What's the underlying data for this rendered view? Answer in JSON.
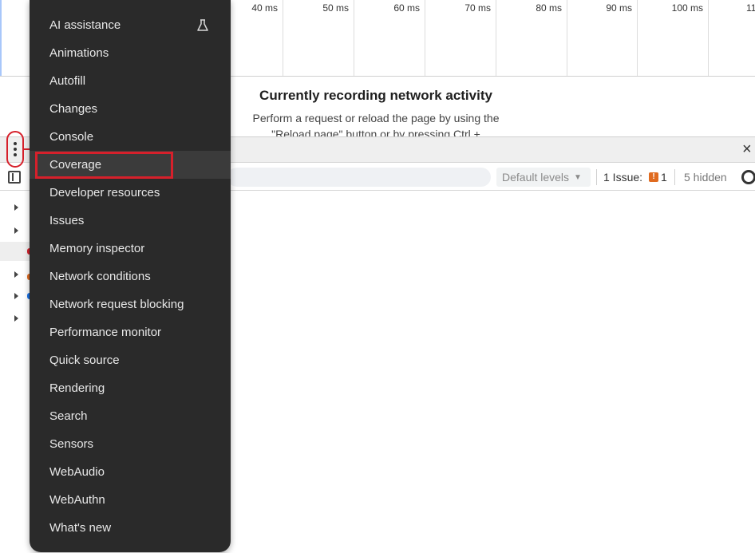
{
  "timeline": {
    "ticks": [
      "40 ms",
      "50 ms",
      "60 ms",
      "70 ms",
      "80 ms",
      "90 ms",
      "100 ms",
      "11"
    ]
  },
  "network": {
    "title": "Currently recording network activity",
    "description": "Perform a request or reload the page by using the \"Reload page\" button or by pressing Ctrl +"
  },
  "drawer": {
    "close_glyph": "×"
  },
  "console_toolbar": {
    "levels_label": "Default levels",
    "issues_label": "1 Issue:",
    "issue_count": "1",
    "hidden_label": "5 hidden"
  },
  "menu": {
    "items": [
      {
        "label": "AI assistance",
        "icon": "flask-icon"
      },
      {
        "label": "Animations"
      },
      {
        "label": "Autofill"
      },
      {
        "label": "Changes"
      },
      {
        "label": "Console"
      },
      {
        "label": "Coverage"
      },
      {
        "label": "Developer resources"
      },
      {
        "label": "Issues"
      },
      {
        "label": "Memory inspector"
      },
      {
        "label": "Network conditions"
      },
      {
        "label": "Network request blocking"
      },
      {
        "label": "Performance monitor"
      },
      {
        "label": "Quick source"
      },
      {
        "label": "Rendering"
      },
      {
        "label": "Search"
      },
      {
        "label": "Sensors"
      },
      {
        "label": "WebAudio"
      },
      {
        "label": "WebAuthn"
      },
      {
        "label": "What's new"
      }
    ],
    "selected": "Coverage"
  },
  "colors": {
    "menu_background": "#2a2a2a",
    "annotation_red": "#d6202b",
    "issue_orange": "#e06b20"
  }
}
